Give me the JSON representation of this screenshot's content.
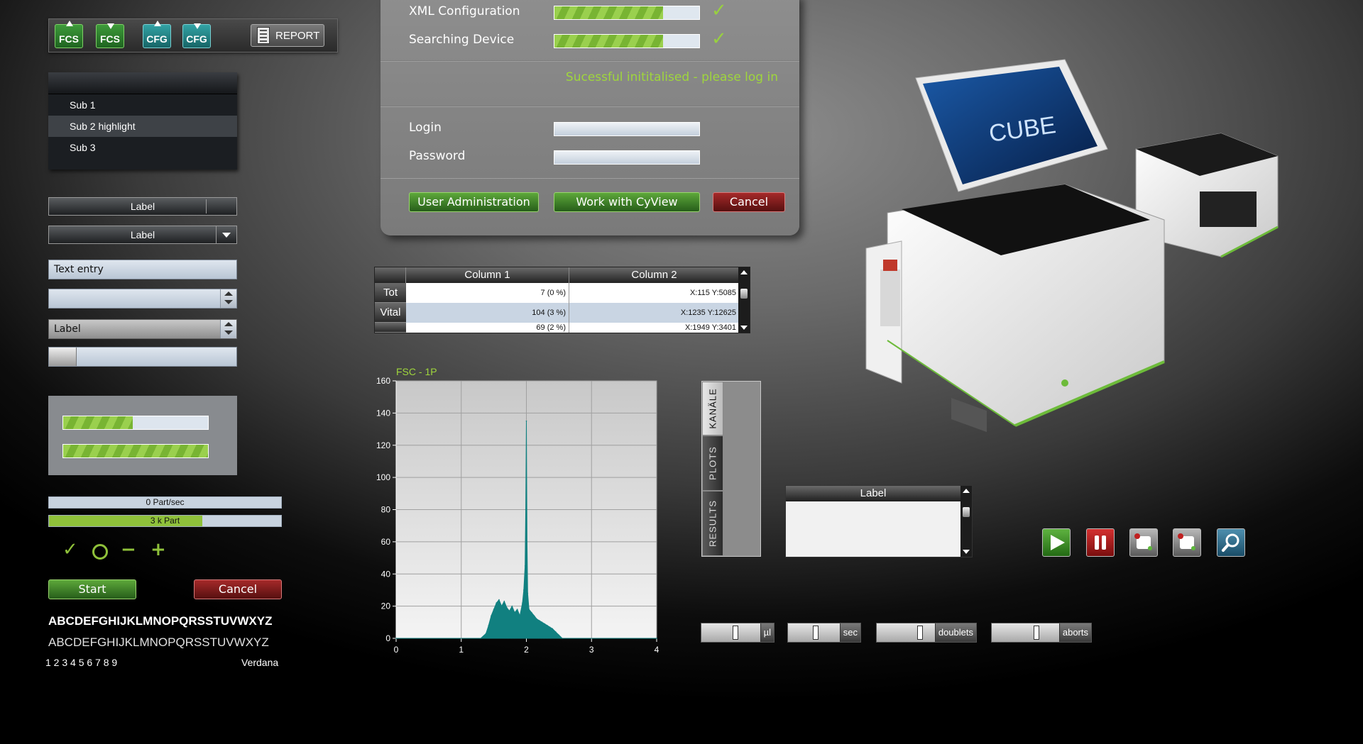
{
  "toolbar": {
    "buttons": [
      {
        "label": "FCS",
        "arrow": "up"
      },
      {
        "label": "FCS",
        "arrow": "down"
      },
      {
        "label": "CFG",
        "arrow": "up"
      },
      {
        "label": "CFG",
        "arrow": "down"
      }
    ],
    "report_label": "REPORT"
  },
  "menu": {
    "items": [
      "Sub 1",
      "Sub 2 highlight",
      "Sub 3"
    ]
  },
  "controls": {
    "label_bar": "Label",
    "label_dropdown": "Label",
    "text_entry": "Text entry",
    "number_value": "",
    "select_value": "Label"
  },
  "progress_panel": {
    "bar1_fraction": 0.48,
    "bar2_fraction": 1.0
  },
  "rates": {
    "rate1_text": "0 Part/sec",
    "rate1_fraction": 0,
    "rate2_text": "3 k Part",
    "rate2_fraction": 0.66
  },
  "symbols": {
    "check": "✓",
    "minus": "−",
    "plus": "+"
  },
  "buttons": {
    "start": "Start",
    "cancel": "Cancel"
  },
  "typography": {
    "bold_alphabet": "ABCDEFGHIJKLMNOPQRSSTUVWXYZ",
    "light_alphabet": "ABCDEFGHIJKLMNOPQRSSTUVWXYZ",
    "digits": "1 2 3 4 5 6 7 8 9",
    "font_name": "Verdana"
  },
  "dialog": {
    "xml_label": "XML Configuration",
    "xml_fraction": 0.75,
    "search_label": "Searching Device",
    "search_fraction": 0.75,
    "status_message": "Sucessful inititalised - please log in",
    "login_label": "Login",
    "password_label": "Password",
    "login_value": "",
    "password_value": "",
    "user_admin": "User Administration",
    "work_cyview": "Work with CyView",
    "cancel": "Cancel",
    "check": "✓"
  },
  "table": {
    "columns": [
      "Column 1",
      "Column 2"
    ],
    "rows": [
      {
        "header": "Tot",
        "c1": "7 (0 %)",
        "c2": "X:115 Y:5085"
      },
      {
        "header": "Vital",
        "c1": "104 (3 %)",
        "c2": "X:1235 Y:12625"
      },
      {
        "header": "",
        "c1": "69 (2 %)",
        "c2": "X:1949 Y:3401"
      }
    ]
  },
  "tabs": [
    "KANÄLE",
    "PLOTS",
    "RESULTS"
  ],
  "label_box": {
    "title": "Label"
  },
  "steppers": [
    {
      "unit": "µl",
      "fraction": 0.6
    },
    {
      "unit": "sec",
      "fraction": 0.55
    },
    {
      "unit": "doublets",
      "fraction": 0.8
    },
    {
      "unit": "aborts",
      "fraction": 0.7
    }
  ],
  "colors": {
    "accent_green": "#8fc13a",
    "status_green": "#9fd63c",
    "histogram": "#118080",
    "cancel_red": "#8c1c1c"
  },
  "media_icons": [
    "play-icon",
    "pause-icon",
    "record-icon",
    "stop-icon",
    "magnifier-icon"
  ],
  "chart_data": {
    "type": "area",
    "title": "FSC - 1P",
    "xlabel": "",
    "ylabel": "",
    "xlim": [
      0,
      4
    ],
    "ylim": [
      0,
      160
    ],
    "xticks": [
      0,
      1,
      2,
      3,
      4
    ],
    "yticks": [
      0,
      20,
      40,
      60,
      80,
      100,
      120,
      140,
      160
    ],
    "grid": true,
    "series": [
      {
        "x": [
          0,
          1.3,
          1.38,
          1.42,
          1.46,
          1.5,
          1.54,
          1.58,
          1.62,
          1.66,
          1.7,
          1.74,
          1.78,
          1.82,
          1.86,
          1.9,
          1.94,
          1.96,
          1.98,
          1.99,
          2.0,
          2.01,
          2.02,
          2.04,
          2.08,
          2.12,
          2.16,
          2.2,
          2.24,
          2.28,
          2.32,
          2.36,
          2.4,
          2.45,
          2.5,
          2.55,
          4
        ],
        "y": [
          0,
          0,
          3,
          8,
          14,
          18,
          22,
          24,
          20,
          23,
          19,
          17,
          20,
          16,
          18,
          14,
          22,
          30,
          45,
          80,
          135,
          60,
          28,
          18,
          16,
          14,
          12,
          11,
          10,
          9,
          8,
          7,
          6,
          4,
          2,
          0,
          0
        ]
      }
    ]
  }
}
